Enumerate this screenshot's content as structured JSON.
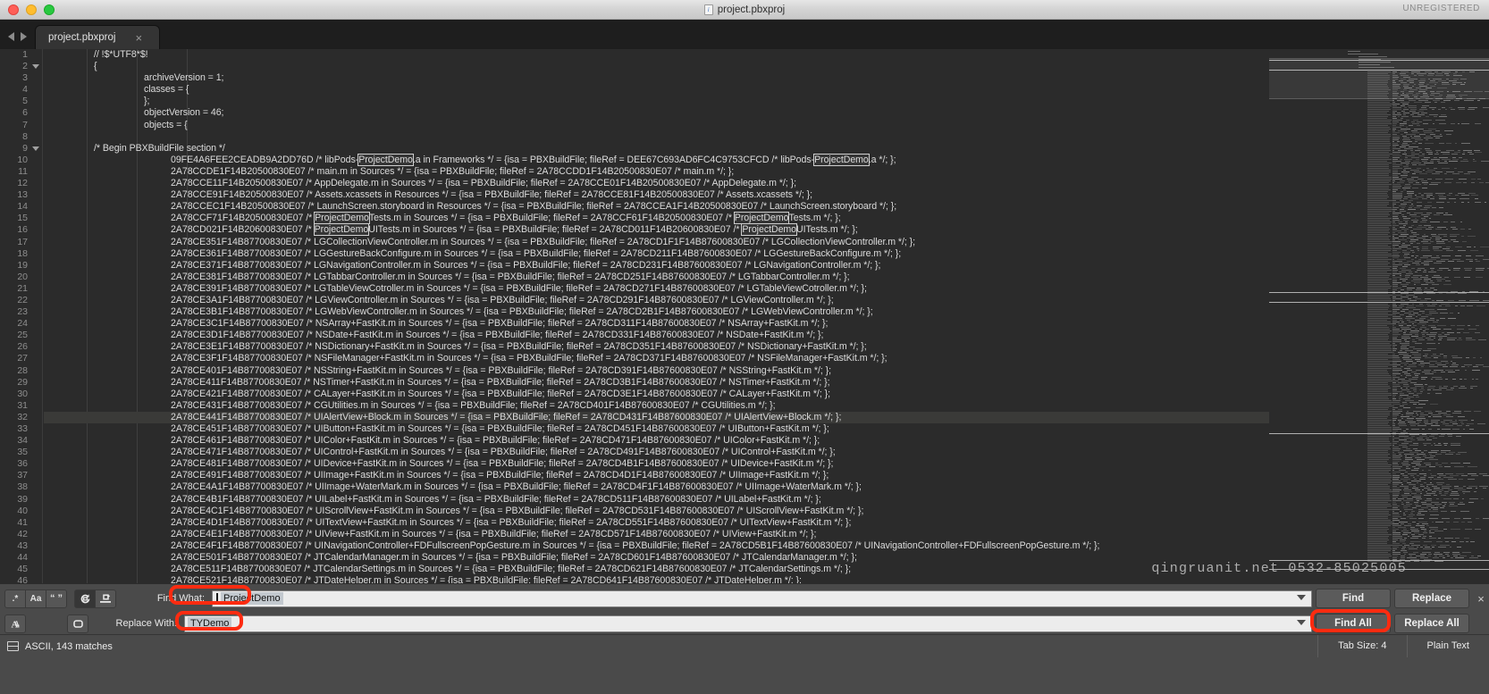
{
  "window": {
    "title": "project.pbxproj",
    "unregistered_label": "UNREGISTERED",
    "doc_icon": "document-icon",
    "traffic_lights": [
      "close",
      "minimize",
      "zoom"
    ]
  },
  "tabbar": {
    "back_icon": "arrow-left-icon",
    "forward_icon": "arrow-right-icon",
    "tabs": [
      {
        "label": "project.pbxproj",
        "close": "×",
        "active": true
      }
    ]
  },
  "editor": {
    "first_line_number": 1,
    "highlight_line": 32,
    "lines": [
      {
        "n": 1,
        "indent": 1,
        "text": "// !$*UTF8*$!",
        "fold": false
      },
      {
        "n": 2,
        "indent": 1,
        "text": "{",
        "fold": true
      },
      {
        "n": 3,
        "indent": 2,
        "text": "archiveVersion = 1;",
        "fold": false
      },
      {
        "n": 4,
        "indent": 2,
        "text": "classes = {",
        "fold": false
      },
      {
        "n": 5,
        "indent": 2,
        "text": "};",
        "fold": false
      },
      {
        "n": 6,
        "indent": 2,
        "text": "objectVersion = 46;",
        "fold": false
      },
      {
        "n": 7,
        "indent": 2,
        "text": "objects = {",
        "fold": false
      },
      {
        "n": 8,
        "indent": 1,
        "text": "",
        "fold": false
      },
      {
        "n": 9,
        "indent": 1,
        "text": "/* Begin PBXBuildFile section */",
        "fold": true
      },
      {
        "n": 10,
        "indent": 3,
        "text": "09FE4A6FEE2CEADB9A2DD76D /* libPods-",
        "match": "ProjectDemo",
        "text2": ".a in Frameworks */ = {isa = PBXBuildFile; fileRef = DEE67C693AD6FC4C9753CFCD /* libPods-",
        "match2": "ProjectDemo",
        "text3": ".a */; };"
      },
      {
        "n": 11,
        "indent": 3,
        "text": "2A78CCDE1F14B20500830E07 /* main.m in Sources */ = {isa = PBXBuildFile; fileRef = 2A78CCDD1F14B20500830E07 /* main.m */; };"
      },
      {
        "n": 12,
        "indent": 3,
        "text": "2A78CCE11F14B20500830E07 /* AppDelegate.m in Sources */ = {isa = PBXBuildFile; fileRef = 2A78CCE01F14B20500830E07 /* AppDelegate.m */; };"
      },
      {
        "n": 13,
        "indent": 3,
        "text": "2A78CCE91F14B20500830E07 /* Assets.xcassets in Resources */ = {isa = PBXBuildFile; fileRef = 2A78CCE81F14B20500830E07 /* Assets.xcassets */; };"
      },
      {
        "n": 14,
        "indent": 3,
        "text": "2A78CCEC1F14B20500830E07 /* LaunchScreen.storyboard in Resources */ = {isa = PBXBuildFile; fileRef = 2A78CCEA1F14B20500830E07 /* LaunchScreen.storyboard */; };"
      },
      {
        "n": 15,
        "indent": 3,
        "text": "2A78CCF71F14B20500830E07 /* ",
        "match": "ProjectDemo",
        "text2": "Tests.m in Sources */ = {isa = PBXBuildFile; fileRef = 2A78CCF61F14B20500830E07 /* ",
        "match2": "ProjectDemo",
        "text3": "Tests.m */; };"
      },
      {
        "n": 16,
        "indent": 3,
        "text": "2A78CD021F14B20600830E07 /* ",
        "match": "ProjectDemo",
        "text2": "UITests.m in Sources */ = {isa = PBXBuildFile; fileRef = 2A78CD011F14B20600830E07 /* ",
        "match2": "ProjectDemo",
        "text3": "UITests.m */; };"
      },
      {
        "n": 17,
        "indent": 3,
        "text": "2A78CE351F14B87700830E07 /* LGCollectionViewController.m in Sources */ = {isa = PBXBuildFile; fileRef = 2A78CD1F1F14B87600830E07 /* LGCollectionViewController.m */; };"
      },
      {
        "n": 18,
        "indent": 3,
        "text": "2A78CE361F14B87700830E07 /* LGGestureBackConfigure.m in Sources */ = {isa = PBXBuildFile; fileRef = 2A78CD211F14B87600830E07 /* LGGestureBackConfigure.m */; };"
      },
      {
        "n": 19,
        "indent": 3,
        "text": "2A78CE371F14B87700830E07 /* LGNavigationController.m in Sources */ = {isa = PBXBuildFile; fileRef = 2A78CD231F14B87600830E07 /* LGNavigationController.m */; };"
      },
      {
        "n": 20,
        "indent": 3,
        "text": "2A78CE381F14B87700830E07 /* LGTabbarController.m in Sources */ = {isa = PBXBuildFile; fileRef = 2A78CD251F14B87600830E07 /* LGTabbarController.m */; };"
      },
      {
        "n": 21,
        "indent": 3,
        "text": "2A78CE391F14B87700830E07 /* LGTableViewCotroller.m in Sources */ = {isa = PBXBuildFile; fileRef = 2A78CD271F14B87600830E07 /* LGTableViewCotroller.m */; };"
      },
      {
        "n": 22,
        "indent": 3,
        "text": "2A78CE3A1F14B87700830E07 /* LGViewController.m in Sources */ = {isa = PBXBuildFile; fileRef = 2A78CD291F14B87600830E07 /* LGViewController.m */; };"
      },
      {
        "n": 23,
        "indent": 3,
        "text": "2A78CE3B1F14B87700830E07 /* LGWebViewController.m in Sources */ = {isa = PBXBuildFile; fileRef = 2A78CD2B1F14B87600830E07 /* LGWebViewController.m */; };"
      },
      {
        "n": 24,
        "indent": 3,
        "text": "2A78CE3C1F14B87700830E07 /* NSArray+FastKit.m in Sources */ = {isa = PBXBuildFile; fileRef = 2A78CD311F14B87600830E07 /* NSArray+FastKit.m */; };"
      },
      {
        "n": 25,
        "indent": 3,
        "text": "2A78CE3D1F14B87700830E07 /* NSDate+FastKit.m in Sources */ = {isa = PBXBuildFile; fileRef = 2A78CD331F14B87600830E07 /* NSDate+FastKit.m */; };"
      },
      {
        "n": 26,
        "indent": 3,
        "text": "2A78CE3E1F14B87700830E07 /* NSDictionary+FastKit.m in Sources */ = {isa = PBXBuildFile; fileRef = 2A78CD351F14B87600830E07 /* NSDictionary+FastKit.m */; };"
      },
      {
        "n": 27,
        "indent": 3,
        "text": "2A78CE3F1F14B87700830E07 /* NSFileManager+FastKit.m in Sources */ = {isa = PBXBuildFile; fileRef = 2A78CD371F14B87600830E07 /* NSFileManager+FastKit.m */; };"
      },
      {
        "n": 28,
        "indent": 3,
        "text": "2A78CE401F14B87700830E07 /* NSString+FastKit.m in Sources */ = {isa = PBXBuildFile; fileRef = 2A78CD391F14B87600830E07 /* NSString+FastKit.m */; };"
      },
      {
        "n": 29,
        "indent": 3,
        "text": "2A78CE411F14B87700830E07 /* NSTimer+FastKit.m in Sources */ = {isa = PBXBuildFile; fileRef = 2A78CD3B1F14B87600830E07 /* NSTimer+FastKit.m */; };"
      },
      {
        "n": 30,
        "indent": 3,
        "text": "2A78CE421F14B87700830E07 /* CALayer+FastKit.m in Sources */ = {isa = PBXBuildFile; fileRef = 2A78CD3E1F14B87600830E07 /* CALayer+FastKit.m */; };"
      },
      {
        "n": 31,
        "indent": 3,
        "text": "2A78CE431F14B87700830E07 /* CGUtilities.m in Sources */ = {isa = PBXBuildFile; fileRef = 2A78CD401F14B87600830E07 /* CGUtilities.m */; };"
      },
      {
        "n": 32,
        "indent": 3,
        "text": "2A78CE441F14B87700830E07 /* UIAlertView+Block.m in Sources */ = {isa = PBXBuildFile; fileRef = 2A78CD431F14B87600830E07 /* UIAlertView+Block.m */; };"
      },
      {
        "n": 33,
        "indent": 3,
        "text": "2A78CE451F14B87700830E07 /* UIButton+FastKit.m in Sources */ = {isa = PBXBuildFile; fileRef = 2A78CD451F14B87600830E07 /* UIButton+FastKit.m */; };"
      },
      {
        "n": 34,
        "indent": 3,
        "text": "2A78CE461F14B87700830E07 /* UIColor+FastKit.m in Sources */ = {isa = PBXBuildFile; fileRef = 2A78CD471F14B87600830E07 /* UIColor+FastKit.m */; };"
      },
      {
        "n": 35,
        "indent": 3,
        "text": "2A78CE471F14B87700830E07 /* UIControl+FastKit.m in Sources */ = {isa = PBXBuildFile; fileRef = 2A78CD491F14B87600830E07 /* UIControl+FastKit.m */; };"
      },
      {
        "n": 36,
        "indent": 3,
        "text": "2A78CE481F14B87700830E07 /* UIDevice+FastKit.m in Sources */ = {isa = PBXBuildFile; fileRef = 2A78CD4B1F14B87600830E07 /* UIDevice+FastKit.m */; };"
      },
      {
        "n": 37,
        "indent": 3,
        "text": "2A78CE491F14B87700830E07 /* UIImage+FastKit.m in Sources */ = {isa = PBXBuildFile; fileRef = 2A78CD4D1F14B87600830E07 /* UIImage+FastKit.m */; };"
      },
      {
        "n": 38,
        "indent": 3,
        "text": "2A78CE4A1F14B87700830E07 /* UIImage+WaterMark.m in Sources */ = {isa = PBXBuildFile; fileRef = 2A78CD4F1F14B87600830E07 /* UIImage+WaterMark.m */; };"
      },
      {
        "n": 39,
        "indent": 3,
        "text": "2A78CE4B1F14B87700830E07 /* UILabel+FastKit.m in Sources */ = {isa = PBXBuildFile; fileRef = 2A78CD511F14B87600830E07 /* UILabel+FastKit.m */; };"
      },
      {
        "n": 40,
        "indent": 3,
        "text": "2A78CE4C1F14B87700830E07 /* UIScrollView+FastKit.m in Sources */ = {isa = PBXBuildFile; fileRef = 2A78CD531F14B87600830E07 /* UIScrollView+FastKit.m */; };"
      },
      {
        "n": 41,
        "indent": 3,
        "text": "2A78CE4D1F14B87700830E07 /* UITextView+FastKit.m in Sources */ = {isa = PBXBuildFile; fileRef = 2A78CD551F14B87600830E07 /* UITextView+FastKit.m */; };"
      },
      {
        "n": 42,
        "indent": 3,
        "text": "2A78CE4E1F14B87700830E07 /* UIView+FastKit.m in Sources */ = {isa = PBXBuildFile; fileRef = 2A78CD571F14B87600830E07 /* UIView+FastKit.m */; };"
      },
      {
        "n": 43,
        "indent": 3,
        "text": "2A78CE4F1F14B87700830E07 /* UINavigationController+FDFullscreenPopGesture.m in Sources */ = {isa = PBXBuildFile; fileRef = 2A78CD5B1F14B87600830E07 /* UINavigationController+FDFullscreenPopGesture.m */; };"
      },
      {
        "n": 44,
        "indent": 3,
        "text": "2A78CE501F14B87700830E07 /* JTCalendarManager.m in Sources */ = {isa = PBXBuildFile; fileRef = 2A78CD601F14B87600830E07 /* JTCalendarManager.m */; };"
      },
      {
        "n": 45,
        "indent": 3,
        "text": "2A78CE511F14B87700830E07 /* JTCalendarSettings.m in Sources */ = {isa = PBXBuildFile; fileRef = 2A78CD621F14B87600830E07 /* JTCalendarSettings.m */; };"
      },
      {
        "n": 46,
        "indent": 3,
        "text": "2A78CE521F14B87700830E07 /* JTDateHelper.m in Sources */ = {isa = PBXBuildFile; fileRef = 2A78CD641F14B87600830E07 /* JTDateHelper.m */; };"
      }
    ]
  },
  "watermark": {
    "text": "qingruanit.net  0532-85025005"
  },
  "find_panel": {
    "option_buttons_row1": [
      {
        "icon": "regex-icon",
        "label": ".*",
        "active": false,
        "name": "use-regex-toggle"
      },
      {
        "icon": "match-case-icon",
        "label": "Aa",
        "active": false,
        "name": "match-case-toggle"
      },
      {
        "icon": "whole-word-icon",
        "label": "“ ”",
        "active": false,
        "name": "whole-word-toggle"
      },
      {
        "icon": "wrap-search-icon",
        "label": "",
        "active": true,
        "name": "wrap-around-toggle"
      },
      {
        "icon": "search-in-selection-icon",
        "label": "",
        "active": false,
        "name": "search-in-selection-toggle"
      }
    ],
    "option_buttons_row2": [
      {
        "icon": "transform-case-icon",
        "label": "",
        "active": false,
        "name": "preserve-case-toggle"
      },
      {
        "icon": "scope-icon",
        "label": "",
        "active": false,
        "name": "replace-scope-toggle"
      }
    ],
    "find_label": "Find What:",
    "find_value": "ProjectDemo",
    "replace_label": "Replace With:",
    "replace_value": "TYDemo",
    "buttons": {
      "find": "Find",
      "replace": "Replace",
      "find_all": "Find All",
      "replace_all": "Replace All"
    },
    "close_icon": "×",
    "dropdown_icon": "chevron-down-icon",
    "highlight_color": "#fd2b10"
  },
  "statusbar": {
    "encoding_icon": "encoding-icon",
    "encoding_text": "ASCII, 143 matches",
    "tab_size": "Tab Size: 4",
    "syntax": "Plain Text"
  }
}
